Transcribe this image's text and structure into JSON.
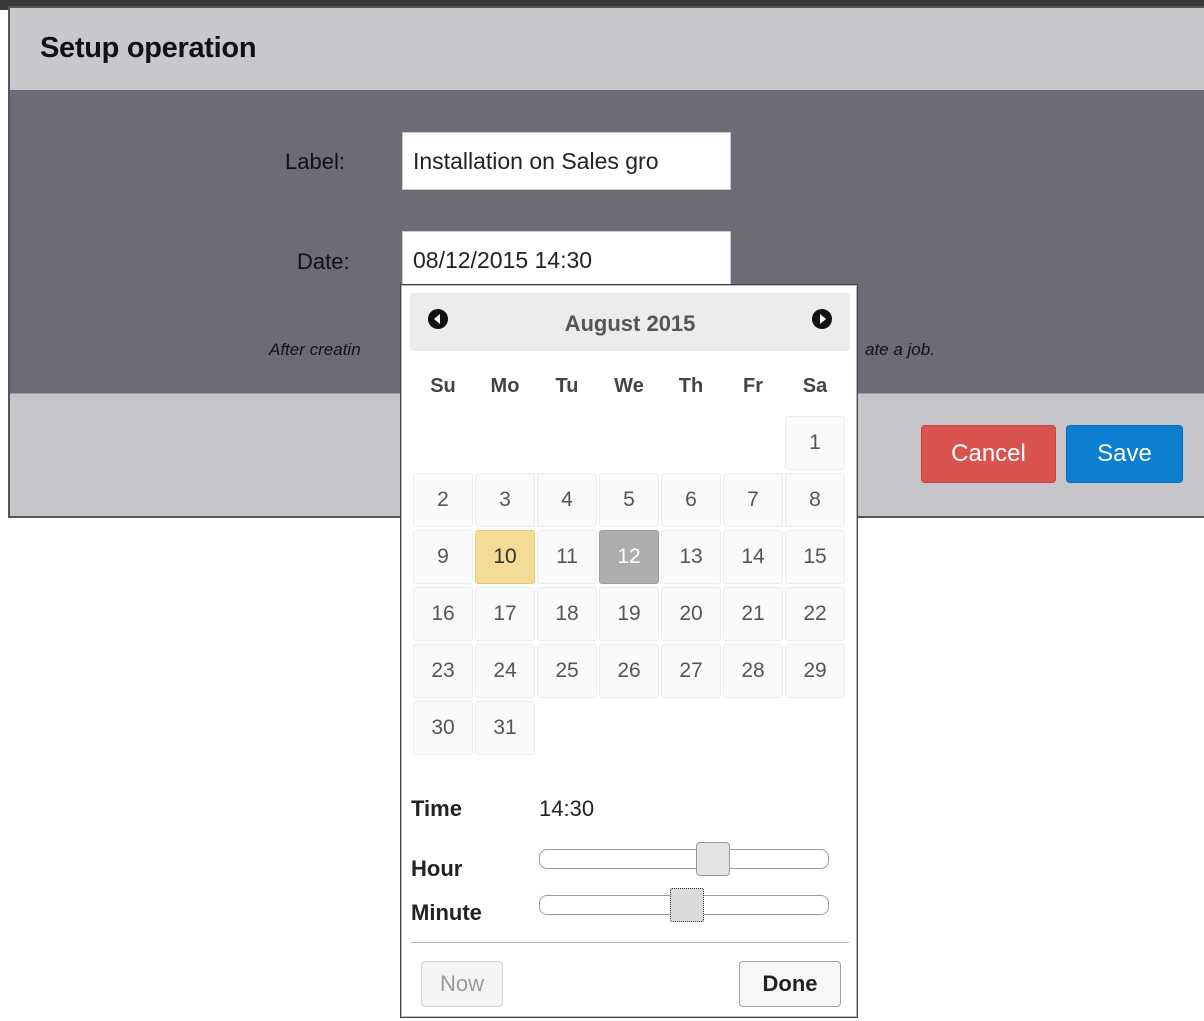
{
  "dialog": {
    "title": "Setup operation",
    "label_field": {
      "label": "Label:",
      "value": "Installation on Sales gro"
    },
    "date_field": {
      "label": "Date:",
      "value": "08/12/2015 14:30"
    },
    "hint_left": "After creatin",
    "hint_right": "ate a job.",
    "cancel_label": "Cancel",
    "save_label": "Save",
    "colors": {
      "cancel": "#d9534f",
      "save": "#0d7fd1",
      "body": "#6e6b76"
    }
  },
  "datepicker": {
    "month_title": "August 2015",
    "prev_icon": "circle-arrow-left-icon",
    "next_icon": "circle-arrow-right-icon",
    "weekdays": [
      "Su",
      "Mo",
      "Tu",
      "We",
      "Th",
      "Fr",
      "Sa"
    ],
    "days": [
      "",
      "",
      "",
      "",
      "",
      "",
      "1",
      "2",
      "3",
      "4",
      "5",
      "6",
      "7",
      "8",
      "9",
      "10",
      "11",
      "12",
      "13",
      "14",
      "15",
      "16",
      "17",
      "18",
      "19",
      "20",
      "21",
      "22",
      "23",
      "24",
      "25",
      "26",
      "27",
      "28",
      "29",
      "30",
      "31",
      "",
      "",
      "",
      "",
      ""
    ],
    "today": "10",
    "selected": "12",
    "time_label": "Time",
    "time_value": "14:30",
    "hour_label": "Hour",
    "hour_value": 14,
    "hour_max": 23,
    "minute_label": "Minute",
    "minute_value": 30,
    "minute_max": 59,
    "now_label": "Now",
    "done_label": "Done",
    "colors": {
      "today": "#f5dc96",
      "selected": "#aeaeae"
    }
  }
}
